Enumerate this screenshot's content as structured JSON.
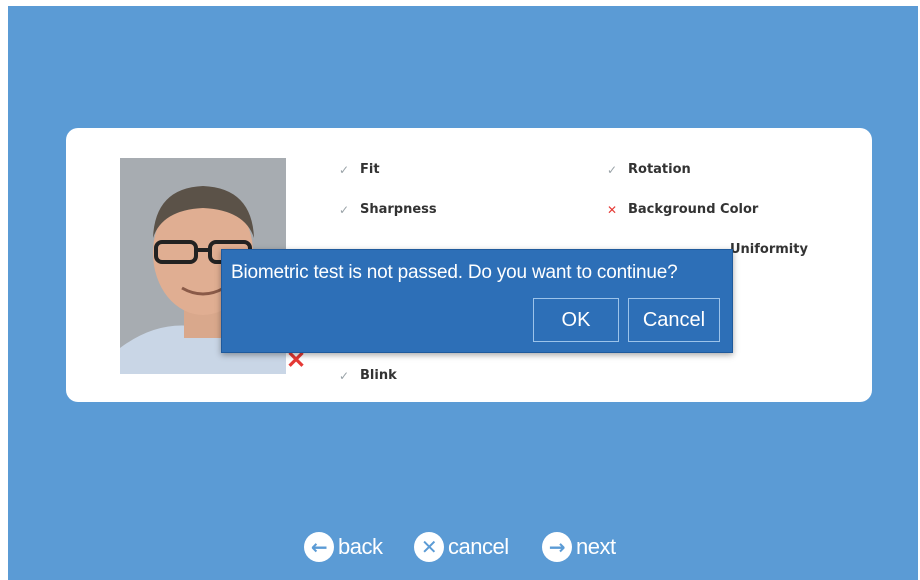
{
  "checks": [
    {
      "label": "Fit",
      "status": "ok"
    },
    {
      "label": "Rotation",
      "status": "ok"
    },
    {
      "label": "Sharpness",
      "status": "ok"
    },
    {
      "label": "Background Color",
      "status": "fail"
    },
    {
      "label": "Uniformity",
      "status": "unknown"
    },
    {
      "label": "Blink",
      "status": "ok"
    }
  ],
  "dialog": {
    "message": "Biometric test is not passed. Do you want to continue?",
    "ok_label": "OK",
    "cancel_label": "Cancel"
  },
  "nav": {
    "back_label": "back",
    "cancel_label": "cancel",
    "next_label": "next"
  },
  "colors": {
    "background": "#5b9bd5",
    "dialog": "#2d6fb7",
    "fail": "#e53935",
    "ok_check": "#9aa3a8"
  },
  "icons": {
    "ok": "check-icon",
    "fail": "cross-icon",
    "back": "arrow-left-circle-icon",
    "cancel": "x-circle-icon",
    "next": "arrow-right-circle-icon"
  }
}
